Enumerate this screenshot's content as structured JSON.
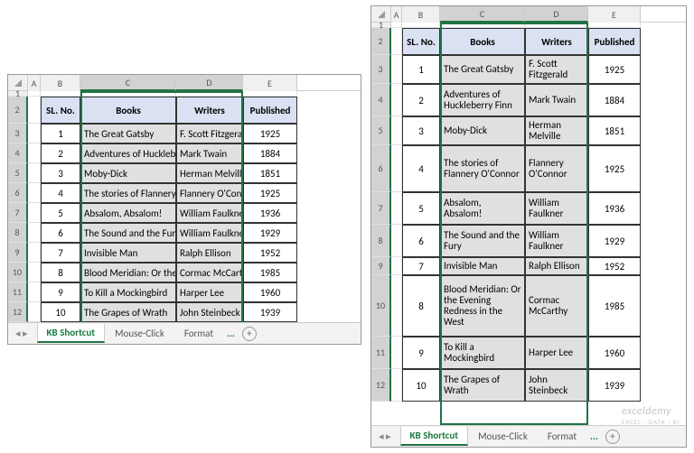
{
  "columns": [
    "A",
    "B",
    "C",
    "D",
    "E"
  ],
  "header_row": {
    "sl": "SL. No.",
    "books": "Books",
    "writers": "Writers",
    "pub": "Published"
  },
  "data": [
    {
      "n": "1",
      "book": "The Great Gatsby",
      "writer": "F. Scott Fitzgerald",
      "year": "1925"
    },
    {
      "n": "2",
      "book": "Adventures of Huckleberry Finn",
      "writer": "Mark Twain",
      "year": "1884"
    },
    {
      "n": "3",
      "book": "Moby-Dick",
      "writer": "Herman Melville",
      "year": "1851"
    },
    {
      "n": "4",
      "book": "The stories of Flannery O'Connor",
      "writer": "Flannery O'Connor",
      "year": "1925"
    },
    {
      "n": "5",
      "book": "Absalom, Absalom!",
      "writer": "William Faulkner",
      "year": "1936"
    },
    {
      "n": "6",
      "book": "The Sound and the Fury",
      "writer": "William Faulkner",
      "year": "1929"
    },
    {
      "n": "7",
      "book": "Invisible Man",
      "writer": "Ralph Ellison",
      "year": "1952"
    },
    {
      "n": "8",
      "book": "Blood Meridian: Or the Evening Redness in the West",
      "writer": "Cormac McCarthy",
      "year": "1985"
    },
    {
      "n": "9",
      "book": "To Kill a Mockingbird",
      "writer": "Harper Lee",
      "year": "1960"
    },
    {
      "n": "10",
      "book": "The Grapes of Wrath",
      "writer": "John Steinbeck",
      "year": "1939"
    }
  ],
  "tabs": {
    "active": "KB Shortcut",
    "others": [
      "Mouse-Click",
      "Format"
    ],
    "more": "..."
  },
  "watermark": {
    "main": "exceldemy",
    "sub": "EXCEL · DATA · BI"
  }
}
